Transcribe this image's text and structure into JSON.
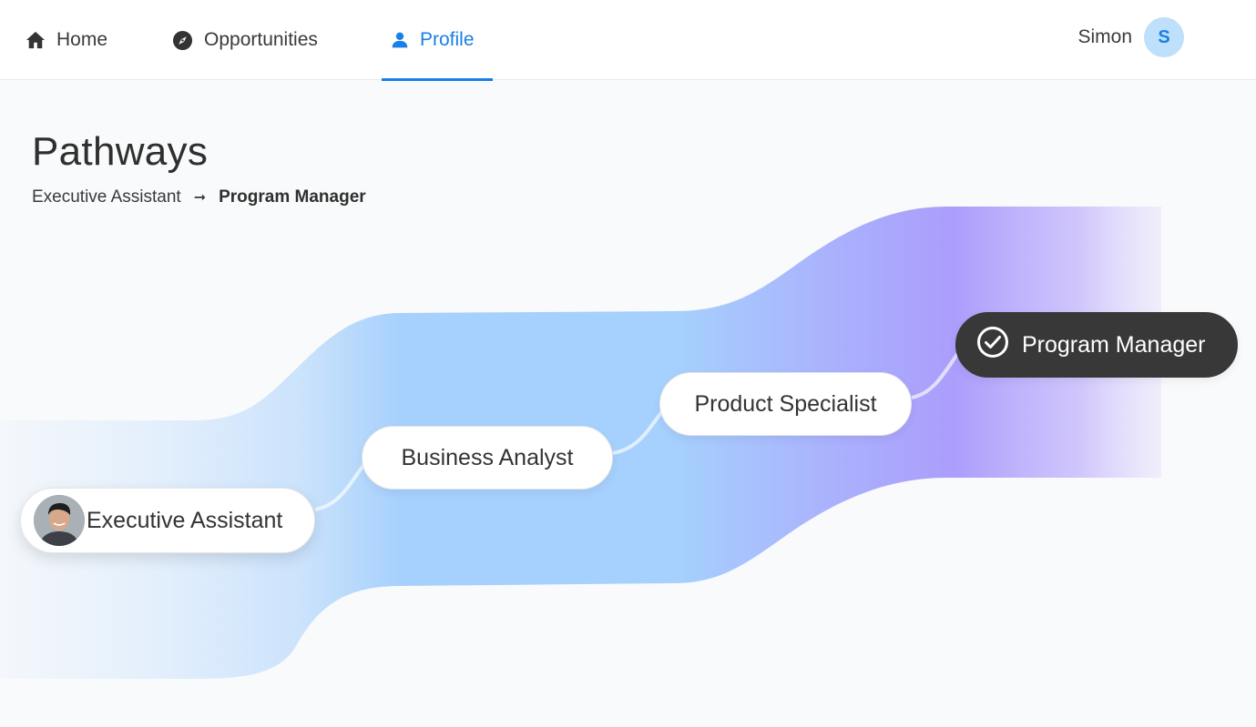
{
  "nav": {
    "items": [
      {
        "label": "Home",
        "icon": "home-icon"
      },
      {
        "label": "Opportunities",
        "icon": "compass-icon"
      },
      {
        "label": "Profile",
        "icon": "person-icon",
        "active": true
      }
    ],
    "user": {
      "name": "Simon",
      "initial": "S"
    }
  },
  "page": {
    "title": "Pathways",
    "breadcrumb": {
      "from": "Executive Assistant",
      "arrow": "➞",
      "to": "Program Manager"
    }
  },
  "pathway": {
    "nodes": [
      {
        "label": "Executive Assistant",
        "has_photo": true
      },
      {
        "label": "Business Analyst"
      },
      {
        "label": "Product Specialist"
      },
      {
        "label": "Program Manager",
        "completed": true
      }
    ]
  },
  "colors": {
    "accent": "#1a7fe6",
    "band_blue": "#a6d0fd",
    "band_purple": "#ab9dfc",
    "target_node": "#383838"
  }
}
